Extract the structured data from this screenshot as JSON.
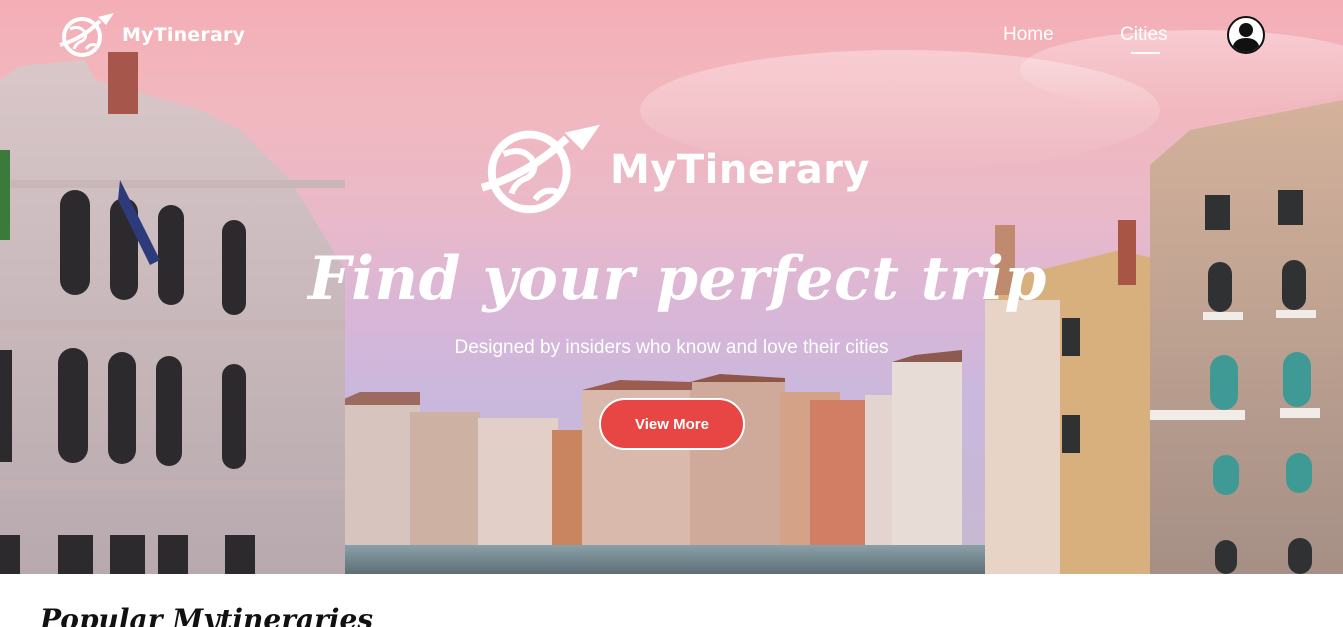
{
  "navbar": {
    "brand": "MyTinerary",
    "links": [
      {
        "label": "Home",
        "active": false
      },
      {
        "label": "Cities",
        "active": true
      }
    ],
    "avatar_icon": "user-avatar-icon"
  },
  "hero": {
    "brand": "MyTinerary",
    "headline": "Find your perfect trip",
    "subline": "Designed by insiders who know and love their cities",
    "cta_label": "View More",
    "background": "venice-grand-canal-photo",
    "colors": {
      "cta": "#e84545",
      "text": "#ffffff"
    }
  },
  "section": {
    "title": "Popular Mytineraries"
  }
}
